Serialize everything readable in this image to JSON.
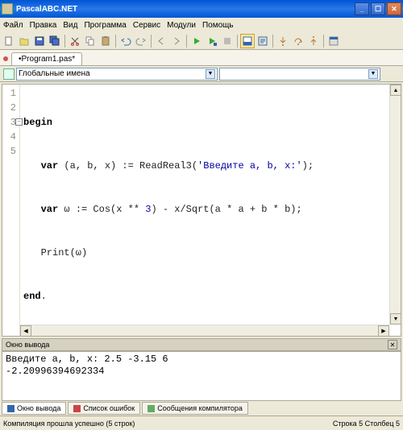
{
  "window": {
    "title": "PascalABC.NET",
    "min": "_",
    "max": "☐",
    "close": "✕"
  },
  "menu": [
    "Файл",
    "Правка",
    "Вид",
    "Программа",
    "Сервис",
    "Модули",
    "Помощь"
  ],
  "tab": {
    "label": "•Program1.pas*"
  },
  "combo": {
    "label": "Глобальные имена",
    "arrow": "▼"
  },
  "gutter": [
    "1",
    "2",
    "3",
    "4",
    "5"
  ],
  "code": {
    "fold": "−",
    "l1_kw": "begin",
    "l2_pre": "   ",
    "l2_kw": "var",
    "l2_a": " (a, b, x) := ReadReal3(",
    "l2_str": "'Введите a, b, x:'",
    "l2_b": ");",
    "l3_pre": "   ",
    "l3_kw": "var",
    "l3_a": " ω := Cos(x ** ",
    "l3_num": "3",
    "l3_b": ") - x/Sqrt(a * a + b * b);",
    "l4": "   Print(ω)",
    "l5_kw": "end",
    "l5_a": "."
  },
  "output_panel": {
    "title": "Окно вывода",
    "x": "✕"
  },
  "output": {
    "l1": "Введите a, b, x: 2.5 -3.15 6",
    "l2": "-2.20996394692334"
  },
  "bottom_tabs": {
    "t1": "Окно вывода",
    "t2": "Список ошибок",
    "t3": "Сообщения компилятора"
  },
  "status": {
    "left": "Компиляция прошла успешно (5 строк)",
    "right": "Строка 5 Столбец 5"
  },
  "scroll": {
    "up": "▲",
    "down": "▼",
    "left": "◀",
    "right": "▶"
  }
}
